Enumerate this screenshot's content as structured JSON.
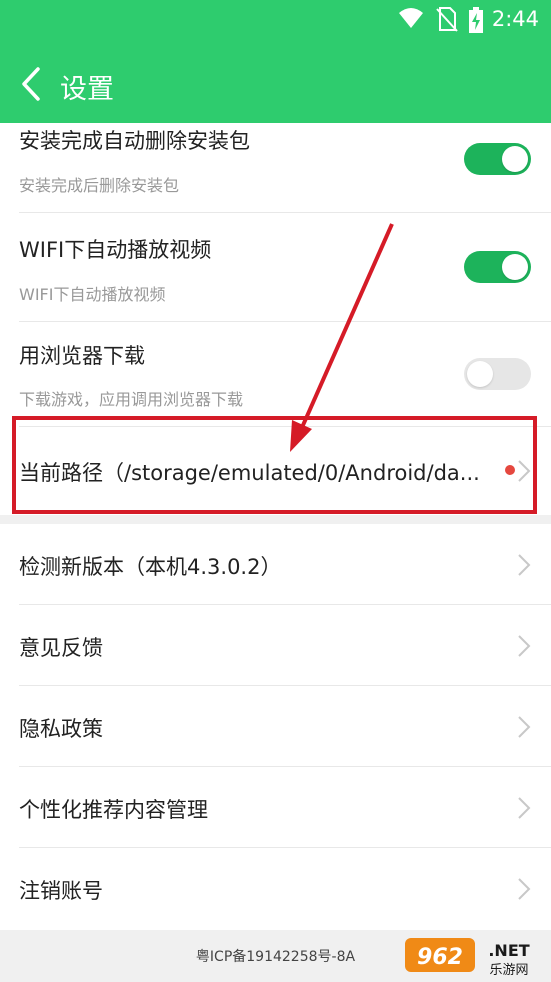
{
  "status_bar": {
    "time": "2:44"
  },
  "header": {
    "title": "设置"
  },
  "settings": {
    "toggle_rows": [
      {
        "label": "安装完成自动删除安装包",
        "sub": "安装完成后删除安装包",
        "on": true
      },
      {
        "label": "WIFI下自动播放视频",
        "sub": "WIFI下自动播放视频",
        "on": true
      },
      {
        "label": "用浏览器下载",
        "sub": "下载游戏，应用调用浏览器下载",
        "on": false
      }
    ],
    "path_row": {
      "label": "当前路径（/storage/emulated/0/Android/da..."
    },
    "link_rows": [
      {
        "label": "检测新版本（本机4.3.0.2）"
      },
      {
        "label": "意见反馈"
      },
      {
        "label": "隐私政策"
      },
      {
        "label": "个性化推荐内容管理"
      },
      {
        "label": "注销账号"
      }
    ]
  },
  "footer": {
    "icp": "粤ICP备19142258号-8A",
    "watermark_text": "962.NET",
    "watermark_sub": "乐游网"
  },
  "colors": {
    "brand": "#2ecc6e",
    "toggle_on": "#1db35b",
    "annotation": "#d51b27",
    "dot": "#e5483f"
  }
}
